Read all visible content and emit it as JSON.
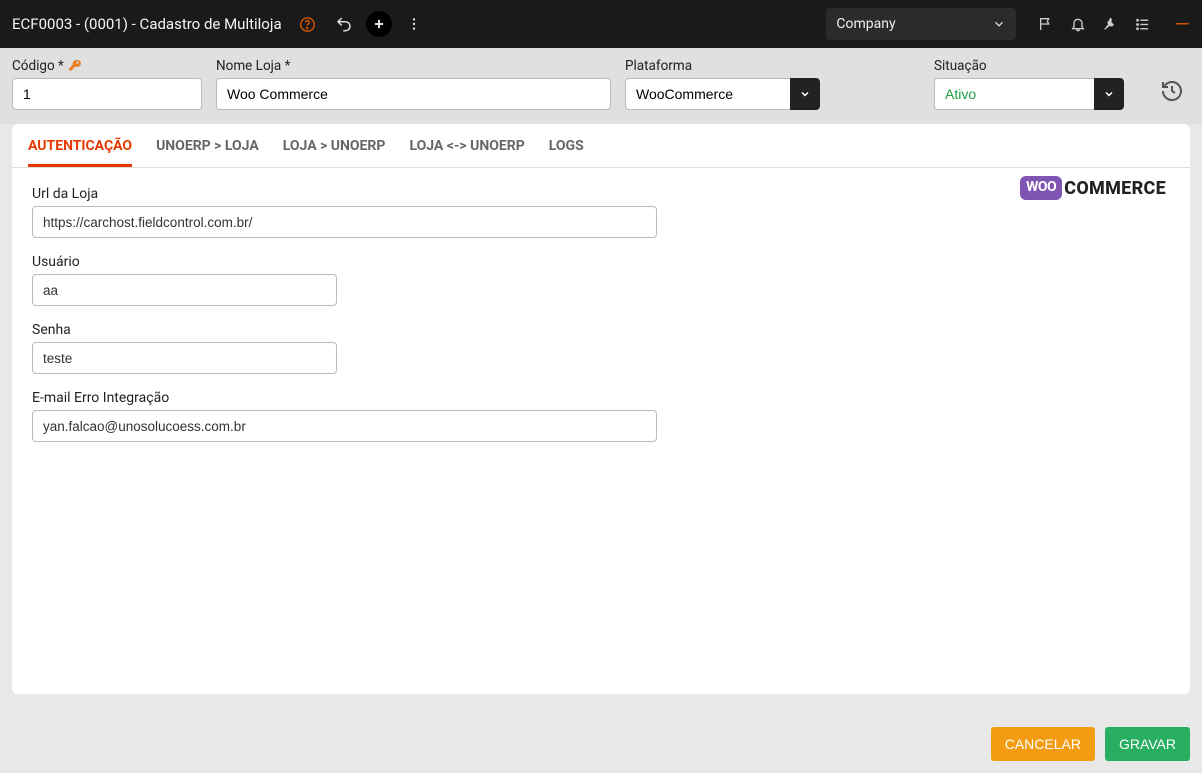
{
  "topbar": {
    "title": "ECF0003 - (0001) - Cadastro de Multiloja",
    "company_selector": "Company"
  },
  "header": {
    "codigo": {
      "label": "Código *",
      "value": "1"
    },
    "nome_loja": {
      "label": "Nome Loja *",
      "value": "Woo Commerce"
    },
    "plataforma": {
      "label": "Plataforma",
      "value": "WooCommerce"
    },
    "situacao": {
      "label": "Situação",
      "value": "Ativo"
    }
  },
  "tabs": {
    "0": {
      "label": "AUTENTICAÇÃO"
    },
    "1": {
      "label": "UNOERP > LOJA"
    },
    "2": {
      "label": "LOJA > UNOERP"
    },
    "3": {
      "label": "LOJA <-> UNOERP"
    },
    "4": {
      "label": "LOGS"
    }
  },
  "auth": {
    "url": {
      "label": "Url da Loja",
      "value": "https://carchost.fieldcontrol.com.br/"
    },
    "usuario": {
      "label": "Usuário",
      "value": "aa"
    },
    "senha": {
      "label": "Senha",
      "value": "teste"
    },
    "email": {
      "label": "E-mail Erro Integração",
      "value": "yan.falcao@unosolucoess.com.br"
    }
  },
  "logo": {
    "woo": "WOO",
    "commerce": "COMMERCE"
  },
  "footer": {
    "cancel": "CANCELAR",
    "save": "GRAVAR"
  }
}
